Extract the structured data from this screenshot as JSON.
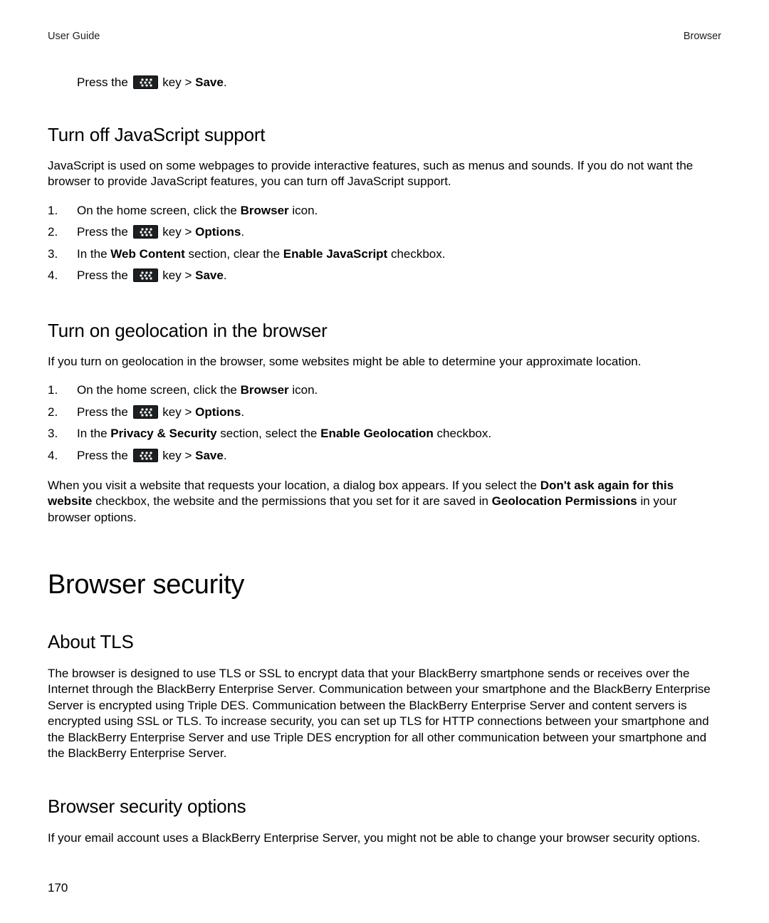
{
  "header": {
    "left": "User Guide",
    "right": "Browser"
  },
  "intro": {
    "prefix": "Press the ",
    "after_icon": " key > ",
    "bold": "Save",
    "suffix": "."
  },
  "s1": {
    "heading": "Turn off JavaScript support",
    "para": "JavaScript is used on some webpages to provide interactive features, such as menus and sounds. If you do not want the browser to provide JavaScript features, you can turn off JavaScript support.",
    "steps": [
      {
        "num": "1.",
        "pre": "On the home screen, click the ",
        "b1": "Browser",
        "post": " icon."
      },
      {
        "num": "2.",
        "pre": "Press the ",
        "icon": true,
        "mid": " key > ",
        "b1": "Options",
        "post": "."
      },
      {
        "num": "3.",
        "pre": "In the ",
        "b1": "Web Content",
        "mid": " section, clear the ",
        "b2": "Enable JavaScript",
        "post": " checkbox."
      },
      {
        "num": "4.",
        "pre": "Press the ",
        "icon": true,
        "mid": " key > ",
        "b1": "Save",
        "post": "."
      }
    ]
  },
  "s2": {
    "heading": "Turn on geolocation in the browser",
    "para": "If you turn on geolocation in the browser, some websites might be able to determine your approximate location.",
    "steps": [
      {
        "num": "1.",
        "pre": "On the home screen, click the ",
        "b1": "Browser",
        "post": " icon."
      },
      {
        "num": "2.",
        "pre": "Press the ",
        "icon": true,
        "mid": " key > ",
        "b1": "Options",
        "post": "."
      },
      {
        "num": "3.",
        "pre": "In the ",
        "b1": "Privacy & Security",
        "mid": " section, select the ",
        "b2": "Enable Geolocation",
        "post": " checkbox."
      },
      {
        "num": "4.",
        "pre": "Press the ",
        "icon": true,
        "mid": " key > ",
        "b1": "Save",
        "post": "."
      }
    ],
    "after": {
      "t1": "When you visit a website that requests your location, a dialog box appears. If you select the ",
      "b1": "Don't ask again for this website",
      "t2": " checkbox, the website and the permissions that you set for it are saved in ",
      "b2": "Geolocation Permissions",
      "t3": " in your browser options."
    }
  },
  "s3": {
    "big": "Browser security",
    "h1": "About TLS",
    "p1": "The browser is designed to use TLS or SSL to encrypt data that your BlackBerry smartphone sends or receives over the Internet through the BlackBerry Enterprise Server. Communication between your smartphone and the BlackBerry Enterprise Server is encrypted using Triple DES. Communication between the BlackBerry Enterprise Server and content servers is encrypted using SSL or TLS. To increase security, you can set up TLS for HTTP connections between your smartphone and the BlackBerry Enterprise Server and use Triple DES encryption for all other communication between your smartphone and the BlackBerry Enterprise Server.",
    "h2": "Browser security options",
    "p2": "If your email account uses a BlackBerry Enterprise Server, you might not be able to change your browser security options."
  },
  "page_number": "170"
}
